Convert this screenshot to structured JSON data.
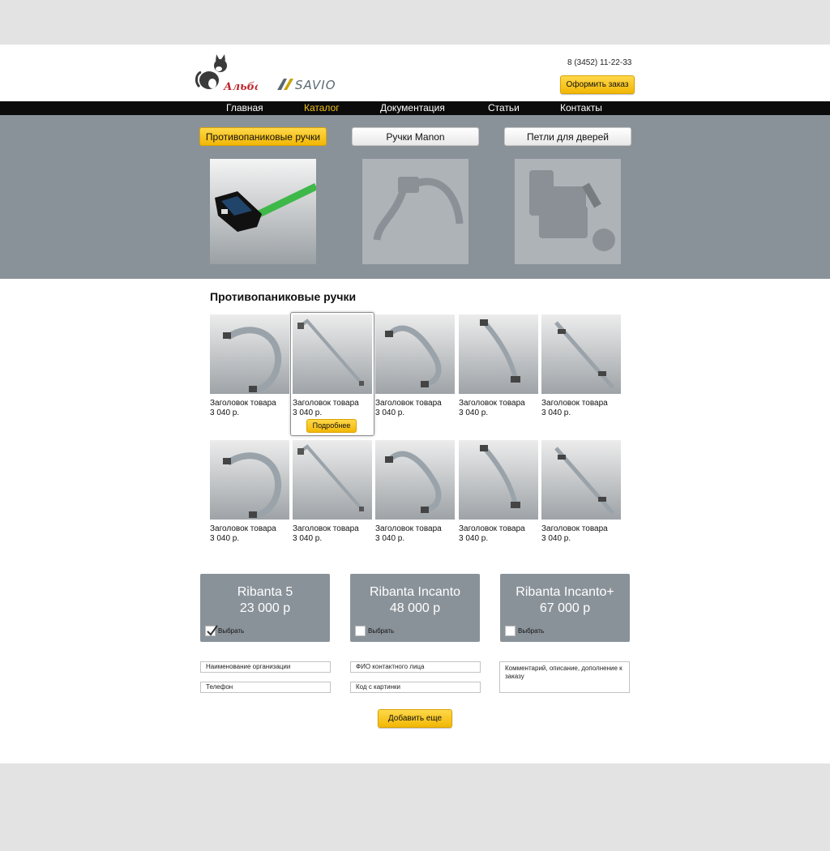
{
  "header": {
    "brand_alba": "Альба",
    "brand_savio": "SAVIO",
    "phone": "8 (3452) 11-22-33",
    "order_button": "Оформить заказ"
  },
  "nav": {
    "items": [
      "Главная",
      "Каталог",
      "Документация",
      "Статьи",
      "Контакты"
    ],
    "active_index": 1
  },
  "categories": {
    "items": [
      "Противопаниковые ручки",
      "Ручки Manon",
      "Петли для дверей"
    ],
    "active_index": 0
  },
  "catalog": {
    "title": "Противопаниковые ручки",
    "products": [
      {
        "title": "Заголовок товара",
        "price": "3 040 р."
      },
      {
        "title": "Заголовок товара",
        "price": "3 040 р."
      },
      {
        "title": "Заголовок товара",
        "price": "3 040 р."
      },
      {
        "title": "Заголовок товара",
        "price": "3 040 р."
      },
      {
        "title": "Заголовок товара",
        "price": "3 040 р."
      },
      {
        "title": "Заголовок товара",
        "price": "3 040 р."
      },
      {
        "title": "Заголовок товара",
        "price": "3 040 р."
      },
      {
        "title": "Заголовок товара",
        "price": "3 040 р."
      },
      {
        "title": "Заголовок товара",
        "price": "3 040 р."
      },
      {
        "title": "Заголовок товара",
        "price": "3 040 р."
      }
    ],
    "more_button": "Подробнее",
    "highlighted_index": 1
  },
  "packages": [
    {
      "name": "Ribanta 5",
      "price": "23 000 р",
      "select_label": "Выбрать",
      "checked": true
    },
    {
      "name": "Ribanta Incanto",
      "price": "48 000 р",
      "select_label": "Выбрать",
      "checked": false
    },
    {
      "name": "Ribanta Incanto+",
      "price": "67 000 р",
      "select_label": "Выбрать",
      "checked": false
    }
  ],
  "form": {
    "organization_placeholder": "Наименование организации",
    "phone_placeholder": "Телефон",
    "contact_placeholder": "ФИО контактного лица",
    "code_placeholder": "Код с картинки",
    "comment_placeholder": "Комментарий, описание, дополнение к заказу",
    "add_button": "Добавить еще"
  },
  "colors": {
    "accent": "#f2c318",
    "nav_bg": "#0b0b0b",
    "hero_bg": "#8a9299"
  }
}
